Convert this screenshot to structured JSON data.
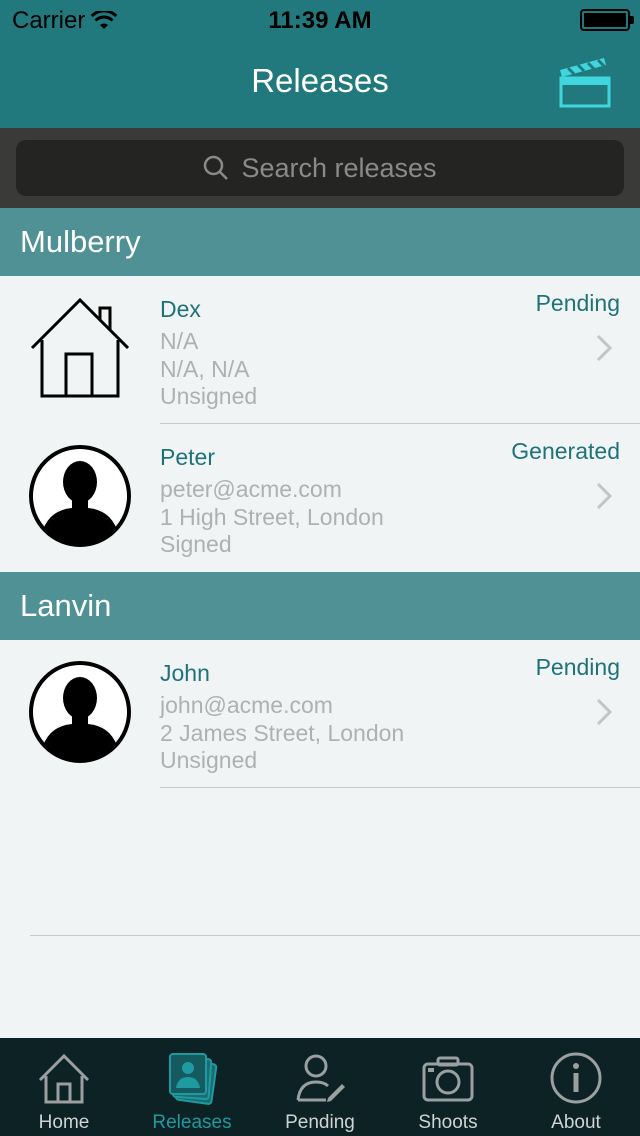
{
  "status_bar": {
    "carrier": "Carrier",
    "time": "11:39 AM"
  },
  "nav": {
    "title": "Releases",
    "action_icon": "clapperboard-icon"
  },
  "search": {
    "placeholder": "Search releases"
  },
  "sections": [
    {
      "title": "Mulberry",
      "rows": [
        {
          "avatar": "house-icon",
          "name": "Dex",
          "line1": "N/A",
          "line2": "N/A, N/A",
          "line3": "Unsigned",
          "status": "Pending"
        },
        {
          "avatar": "person-silhouette-icon",
          "name": "Peter",
          "line1": "peter@acme.com",
          "line2": "1 High Street, London",
          "line3": "Signed",
          "status": "Generated"
        }
      ]
    },
    {
      "title": "Lanvin",
      "rows": [
        {
          "avatar": "person-silhouette-icon",
          "name": "John",
          "line1": "john@acme.com",
          "line2": "2 James Street, London",
          "line3": "Unsigned",
          "status": "Pending"
        }
      ]
    }
  ],
  "tabbar": [
    {
      "label": "Home",
      "icon": "home-icon",
      "active": false
    },
    {
      "label": "Releases",
      "icon": "releases-icon",
      "active": true
    },
    {
      "label": "Pending",
      "icon": "pending-user-icon",
      "active": false
    },
    {
      "label": "Shoots",
      "icon": "camera-icon",
      "active": false
    },
    {
      "label": "About",
      "icon": "info-icon",
      "active": false
    }
  ],
  "colors": {
    "nav_bg": "#21797d",
    "section_bg": "#4f9194",
    "accent": "#1f7378",
    "tab_active": "#1f9aa0"
  }
}
